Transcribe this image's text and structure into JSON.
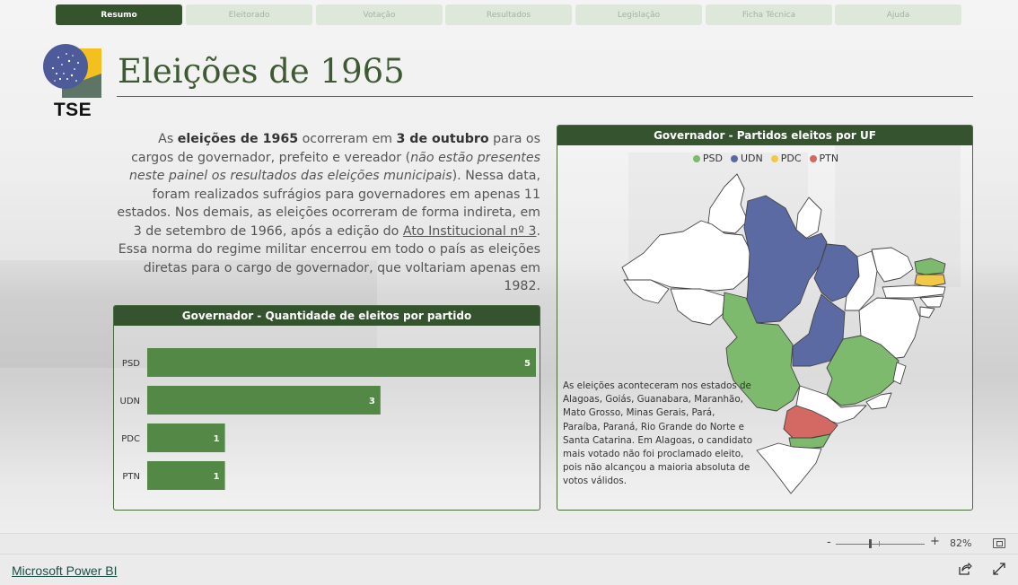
{
  "nav": {
    "tabs": [
      "Resumo",
      "Eleitorado",
      "Votação",
      "Resultados",
      "Legislação",
      "Ficha Técnica",
      "Ajuda"
    ],
    "active_index": 0
  },
  "logo": {
    "text": "TSE"
  },
  "page_title": "Eleições de 1965",
  "intro": {
    "t1": "As ",
    "b1": "eleições de 1965",
    "t2": " ocorreram em ",
    "b2": "3 de outubro",
    "t3": " para os cargos de governador, prefeito e vereador (",
    "i1": "não estão presentes neste painel os resultados das eleições municipais",
    "t4": "). Nessa data, foram realizados sufrágios para governadores em apenas 11 estados. Nos demais, as eleições ocorreram de forma indireta, em 3 de setembro de 1966, após a edição do ",
    "u1": "Ato Institucional nº 3",
    "t5": ". Essa norma do regime militar encerrou em todo o país as eleições diretas para o cargo de governador, que voltariam apenas em 1982."
  },
  "bar_card": {
    "title": "Governador - Quantidade de eleitos por partido"
  },
  "chart_data": {
    "type": "bar",
    "orientation": "horizontal",
    "title": "Governador - Quantidade de eleitos por partido",
    "categories": [
      "PSD",
      "UDN",
      "PDC",
      "PTN"
    ],
    "values": [
      5,
      3,
      1,
      1
    ],
    "color": "#548847",
    "data_labels": true,
    "xlim": [
      0,
      5
    ]
  },
  "map_card": {
    "title": "Governador - Partidos eleitos por UF",
    "legend": [
      {
        "label": "PSD",
        "color": "#7dba6e"
      },
      {
        "label": "UDN",
        "color": "#5c6aa4"
      },
      {
        "label": "PDC",
        "color": "#f2c946"
      },
      {
        "label": "PTN",
        "color": "#d46863"
      }
    ],
    "note": "As eleições aconteceram nos estados de Alagoas, Goiás, Guanabara, Maranhão, Mato Grosso, Minas Gerais, Pará, Paraíba, Paraná, Rio Grande do Norte e Santa Catarina. Em Alagoas, o candidato mais votado não foi proclamado eleito, pois não alcançou a maioria absoluta de votos válidos."
  },
  "status": {
    "zoom_minus": "-",
    "zoom_plus": "+",
    "zoom_value": "82%",
    "zoom_level": 0.38
  },
  "footer": {
    "link": "Microsoft Power BI"
  },
  "icons": {
    "share": "share-icon",
    "expand": "expand-icon",
    "fit": "fit-to-page-icon"
  }
}
